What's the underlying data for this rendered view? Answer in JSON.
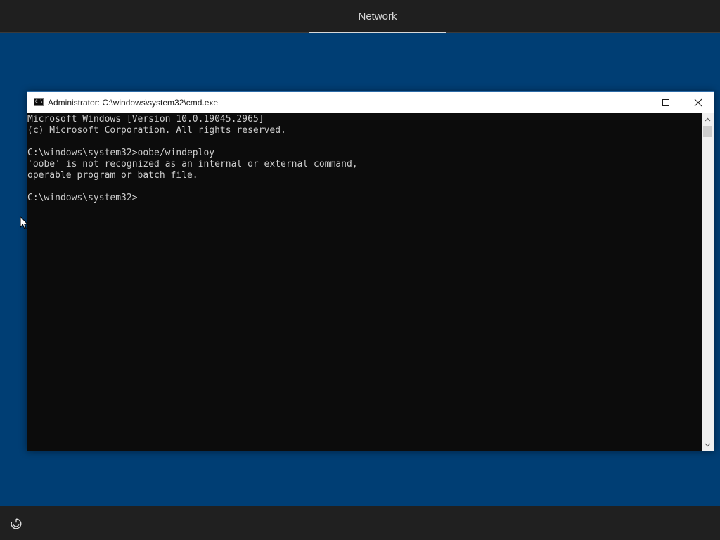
{
  "oobe": {
    "top_tab": "Network",
    "bottom_icon": "ease-of-access-icon"
  },
  "cmd_window": {
    "title": "Administrator: C:\\windows\\system32\\cmd.exe",
    "icon_text": "C:\\",
    "controls": {
      "minimize": "minimize-icon",
      "maximize": "maximize-icon",
      "close": "close-icon"
    },
    "console_lines": [
      "Microsoft Windows [Version 10.0.19045.2965]",
      "(c) Microsoft Corporation. All rights reserved.",
      "",
      "C:\\windows\\system32>oobe/windeploy",
      "'oobe' is not recognized as an internal or external command,",
      "operable program or batch file.",
      "",
      "C:\\windows\\system32>"
    ]
  },
  "colors": {
    "desktop_blue": "#003e74",
    "console_bg": "#0c0c0c",
    "console_text": "#cccccc",
    "titlebar_bg": "#ffffff",
    "oobe_bar": "#1f1f1f"
  }
}
